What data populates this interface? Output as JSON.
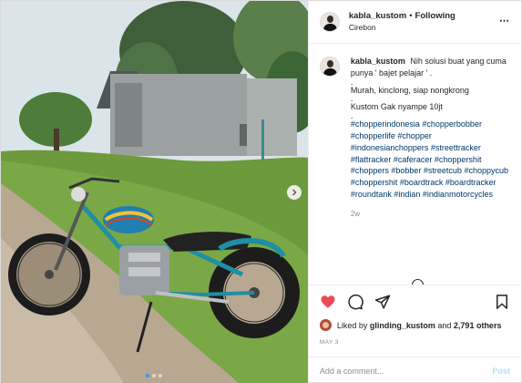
{
  "header": {
    "username": "kabla_kustom",
    "separator": "•",
    "follow_label": "Following",
    "location": "Cirebon",
    "more_icon": "more-horizontal-icon"
  },
  "caption": {
    "username": "kabla_kustom",
    "line1": "Nih solusi buat yang cuma punya ' bajet pelajar ' .",
    "dot1": ".",
    "line2": "Murah, kinclong, siap nongkrong",
    "dot2": ".",
    "line3": "Kustom Gak nyampe 10jt",
    "dot3": ".",
    "hashtags": [
      "#chopperindonesia",
      "#chopperbobber",
      "#chopperlife",
      "#chopper",
      "#indonesianchoppers",
      "#streettracker",
      "#flattracker",
      "#caferacer",
      "#choppershit",
      "#choppers",
      "#bobber",
      "#streetcub",
      "#choppycub",
      "#choppershit",
      "#boardtrack",
      "#boardtracker",
      "#roundtank",
      "#indian",
      "#indianmotorcycles"
    ],
    "time": "2w"
  },
  "actions": {
    "like_icon": "heart-filled-icon",
    "comment_icon": "comment-icon",
    "share_icon": "share-icon",
    "save_icon": "bookmark-icon"
  },
  "likes": {
    "prefix": "Liked by",
    "user": "glinding_kustom",
    "conjunction": "and",
    "others": "2,791 others"
  },
  "date": "MAY 3",
  "comment_box": {
    "placeholder": "Add a comment...",
    "post_label": "Post"
  },
  "carousel": {
    "slide_count": 3,
    "active_index": 0,
    "next_icon": "chevron-right-icon"
  },
  "colors": {
    "heart": "#ed4956",
    "link": "#00376b",
    "post_disabled": "#b2dffc",
    "active_dot": "#3897f0"
  }
}
